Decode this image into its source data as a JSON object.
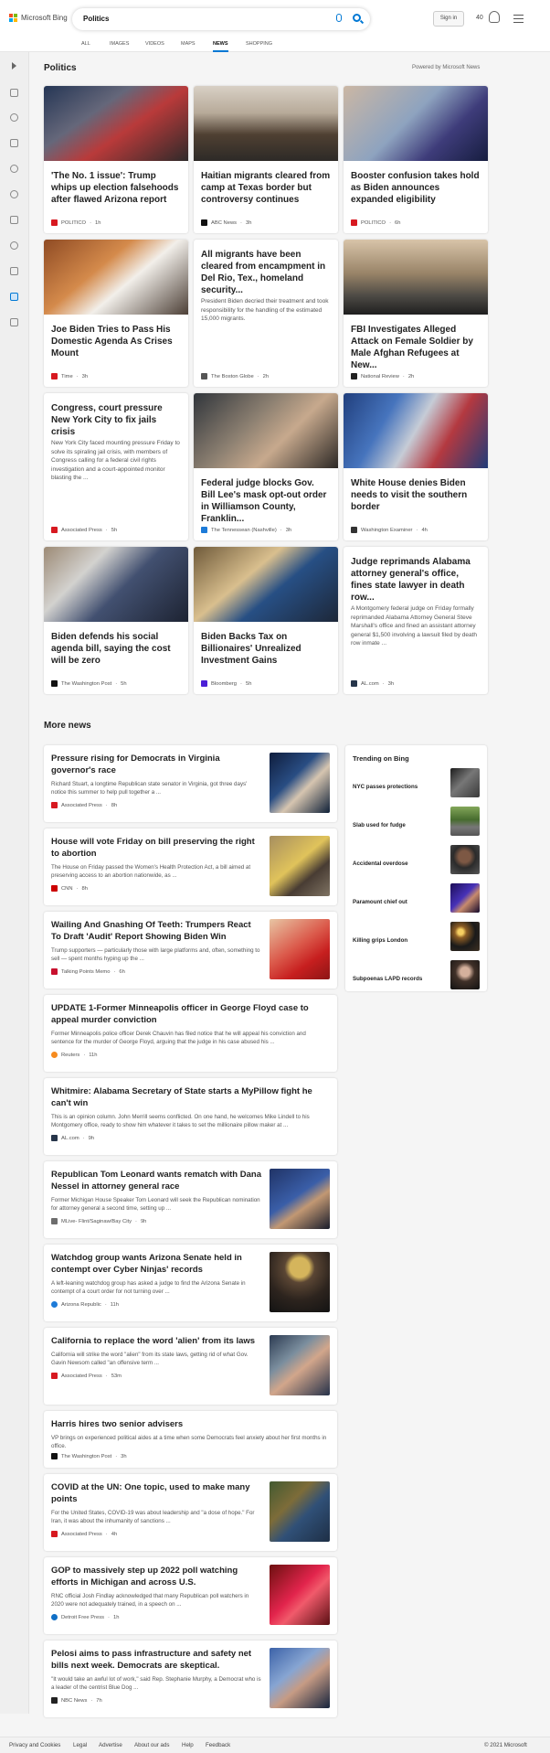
{
  "brand": "Microsoft Bing",
  "search": {
    "query": "Politics"
  },
  "header": {
    "signin": "Sign in",
    "points": "40"
  },
  "nav": [
    "ALL",
    "IMAGES",
    "VIDEOS",
    "MAPS",
    "NEWS",
    "SHOPPING"
  ],
  "section": {
    "title": "Politics",
    "powered": "Powered by Microsoft News",
    "more": "More news"
  },
  "top_cards": [
    {
      "title": "'The No. 1 issue': Trump whips up election falsehoods after flawed Arizona report",
      "source": "POLITICO",
      "age": "1h",
      "logo_color": "#d71920"
    },
    {
      "title": "Haitian migrants cleared from camp at Texas border but controversy continues",
      "source": "ABC News",
      "age": "3h",
      "logo_color": "#111"
    },
    {
      "title": "Booster confusion takes hold as Biden announces expanded eligibility",
      "source": "POLITICO",
      "age": "6h",
      "logo_color": "#d71920"
    },
    {
      "title": "Joe Biden Tries to Pass His Domestic Agenda As Crises Mount",
      "source": "Time",
      "age": "3h",
      "logo_color": "#d71920"
    },
    {
      "title": "All migrants have been cleared from encampment in Del Rio, Tex., homeland security...",
      "desc": "President Biden decried their treatment and took responsibility for the handling of the estimated 15,000 migrants.",
      "source": "The Boston Globe",
      "age": "2h",
      "logo_color": "#555"
    },
    {
      "title": "FBI Investigates Alleged Attack on Female Soldier by Male Afghan Refugees at New...",
      "source": "National Review",
      "age": "2h",
      "logo_color": "#222"
    },
    {
      "title": "Congress, court pressure New York City to fix jails crisis",
      "desc": "New York City faced mounting pressure Friday to solve its spiraling jail crisis, with members of Congress calling for a federal civil rights investigation and a court-appointed monitor blasting the ...",
      "source": "Associated Press",
      "age": "5h",
      "logo_color": "#d71920"
    },
    {
      "title": "Federal judge blocks Gov. Bill Lee's mask opt-out order in Williamson County, Franklin...",
      "source": "The Tennessean (Nashville)",
      "age": "3h",
      "logo_color": "#1d7bd8"
    },
    {
      "title": "White House denies Biden needs to visit the southern border",
      "source": "Washington Examiner",
      "age": "4h",
      "logo_color": "#333"
    },
    {
      "title": "Biden defends his social agenda bill, saying the cost will be zero",
      "source": "The Washington Post",
      "age": "5h",
      "logo_color": "#111"
    },
    {
      "title": "Biden Backs Tax on Billionaires' Unrealized Investment Gains",
      "source": "Bloomberg",
      "age": "5h",
      "logo_color": "#4b1fd6"
    },
    {
      "title": "Judge reprimands Alabama attorney general's office, fines state lawyer in death row...",
      "desc": "A Montgomery federal judge on Friday formally reprimanded Alabama Attorney General Steve Marshall's office and fined an assistant attorney general $1,500 involving a lawsuit filed by death row inmate ...",
      "source": "AL.com",
      "age": "3h",
      "logo_color": "#26354a"
    }
  ],
  "more_news": [
    {
      "title": "Pressure rising for Democrats in Virginia governor's race",
      "desc": "Richard Stuart, a longtime Republican state senator in Virginia, got three days' notice this summer to help pull together a ...",
      "source": "Associated Press",
      "age": "8h",
      "logo_color": "#d71920"
    },
    {
      "title": "House will vote Friday on bill preserving the right to abortion",
      "desc": "The House on Friday passed the Women's Health Protection Act, a bill aimed at preserving access to an abortion nationwide, as ...",
      "source": "CNN",
      "age": "8h",
      "logo_color": "#cc0000"
    },
    {
      "title": "Wailing And Gnashing Of Teeth: Trumpers React To Draft 'Audit' Report Showing Biden Win",
      "desc": "Trump supporters — particularly those with large platforms and, often, something to sell — spent months hyping up the ...",
      "source": "Talking Points Memo",
      "age": "6h",
      "logo_color": "#c8102e"
    },
    {
      "title": "UPDATE 1-Former Minneapolis officer in George Floyd case to appeal murder conviction",
      "desc": "Former Minneapolis police officer Derek Chauvin has filed notice that he will appeal his conviction and sentence for the murder of George Floyd, arguing that the judge in his case abused his ...",
      "source": "Reuters",
      "age": "11h",
      "logo_color": "#f68b1f"
    },
    {
      "title": "Whitmire: Alabama Secretary of State starts a MyPillow fight he can't win",
      "desc": "This is an opinion column. John Merrill seems conflicted. On one hand, he welcomes Mike Lindell to his Montgomery office, ready to show him whatever it takes to set the millionaire pillow maker at ...",
      "source": "AL.com",
      "age": "9h",
      "logo_color": "#26354a"
    },
    {
      "title": "Republican Tom Leonard wants rematch with Dana Nessel in attorney general race",
      "desc": "Former Michigan House Speaker Tom Leonard will seek the Republican nomination for attorney general a second time, setting up ...",
      "source": "MLive- Flint/Saginaw/Bay City",
      "age": "9h",
      "logo_color": "#6d6d6d"
    },
    {
      "title": "Watchdog group wants Arizona Senate held in contempt over Cyber Ninjas' records",
      "desc": "A left-leaning watchdog group has asked a judge to find the Arizona Senate in contempt of a court order for not turning over ...",
      "source": "Arizona Republic",
      "age": "11h",
      "logo_color": "#1d7bd8"
    },
    {
      "title": "California to replace the word 'alien' from its laws",
      "desc": "California will strike the word \"alien\" from its state laws, getting rid of what Gov. Gavin Newsom called \"an offensive term ...",
      "source": "Associated Press",
      "age": "53m",
      "logo_color": "#d71920"
    },
    {
      "title": "Harris hires two senior advisers",
      "desc": "VP brings on experienced political aides at a time when some Democrats feel anxiety about her first months in office.",
      "source": "The Washington Post",
      "age": "3h",
      "logo_color": "#111"
    },
    {
      "title": "COVID at the UN: One topic, used to make many points",
      "desc": "For the United States, COVID-19 was about leadership and \"a dose of hope.\" For Iran, it was about the inhumanity of sanctions ...",
      "source": "Associated Press",
      "age": "4h",
      "logo_color": "#d71920"
    },
    {
      "title": "GOP to massively step up 2022 poll watching efforts in Michigan and across U.S.",
      "desc": "RNC official Josh Findlay acknowledged that many Republican poll watchers in 2020 were not adequately trained, in a speech on ...",
      "source": "Detroit Free Press",
      "age": "1h",
      "logo_color": "#0f6fc6"
    },
    {
      "title": "Pelosi aims to pass infrastructure and safety net bills next week. Democrats are skeptical.",
      "desc": "\"It would take an awful lot of work,\" said Rep. Stephanie Murphy, a Democrat who is a leader of the centrist Blue Dog ...",
      "source": "NBC News",
      "age": "7h",
      "logo_color": "#222"
    }
  ],
  "trending": {
    "title": "Trending on Bing",
    "items": [
      "NYC passes protections",
      "Slab used for fudge",
      "Accidental overdose",
      "Paramount chief out",
      "Killing grips London",
      "Subpoenas LAPD records"
    ]
  },
  "footer": {
    "links": [
      "Privacy and Cookies",
      "Legal",
      "Advertise",
      "About our ads",
      "Help",
      "Feedback"
    ],
    "copyright": "© 2021 Microsoft"
  },
  "colors": {
    "accent": "#0078d4"
  }
}
